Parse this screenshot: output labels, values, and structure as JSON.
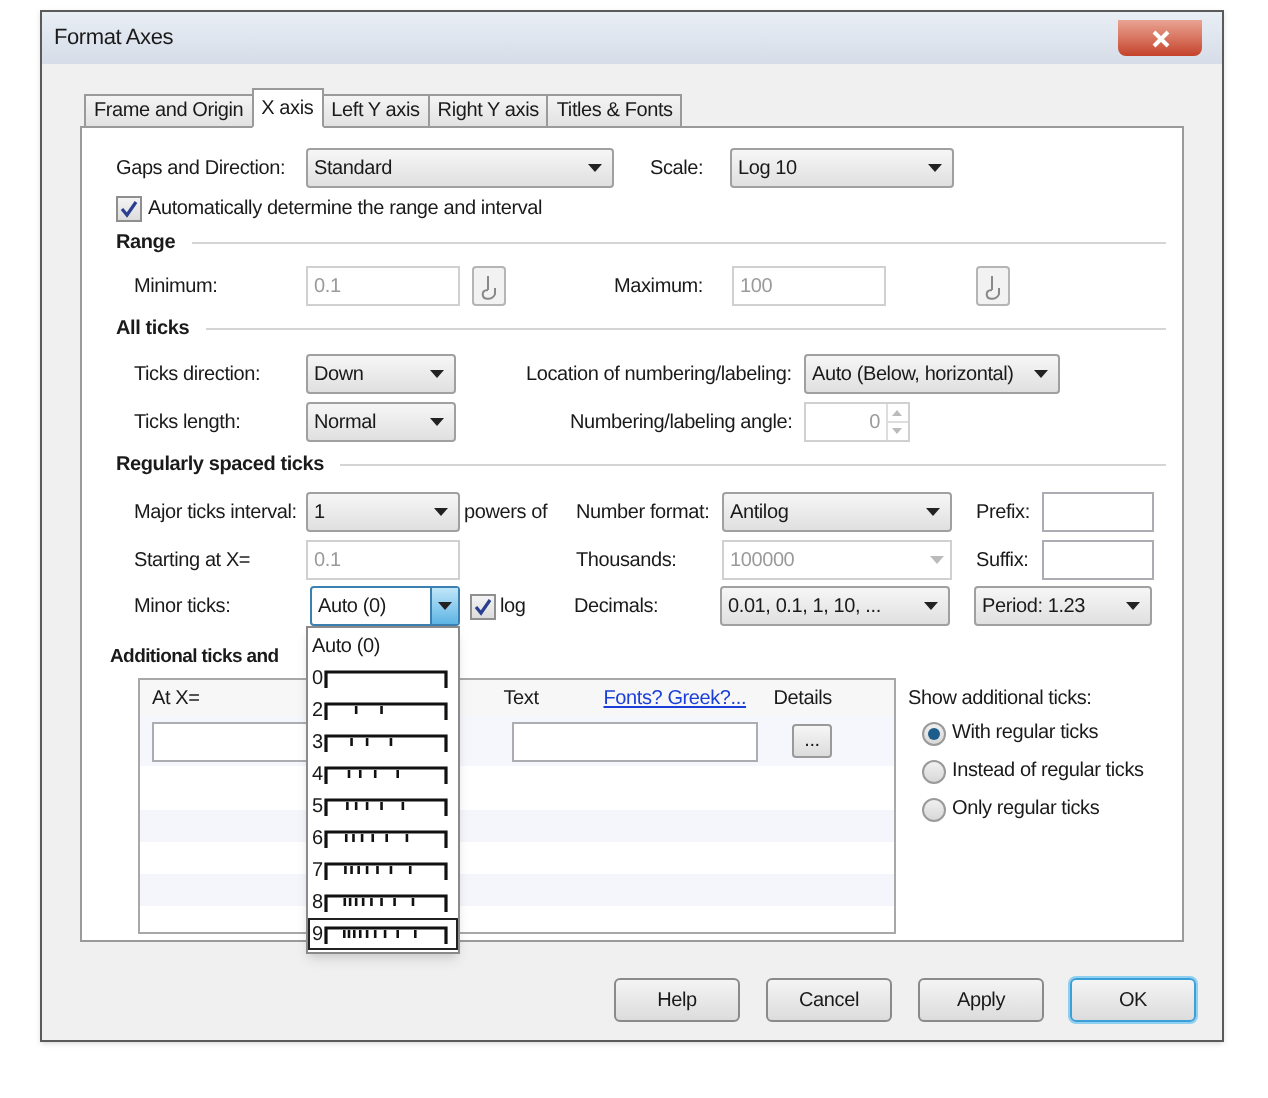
{
  "window": {
    "title": "Format Axes"
  },
  "tabs": [
    {
      "label": "Frame and Origin",
      "selected": false
    },
    {
      "label": "X axis",
      "selected": true
    },
    {
      "label": "Left Y axis",
      "selected": false
    },
    {
      "label": "Right Y axis",
      "selected": false
    },
    {
      "label": "Titles & Fonts",
      "selected": false
    }
  ],
  "gaps_direction": {
    "label": "Gaps and Direction:",
    "value": "Standard"
  },
  "scale": {
    "label": "Scale:",
    "value": "Log 10"
  },
  "auto_range": {
    "label": "Automatically determine the range and interval",
    "checked": true
  },
  "range": {
    "heading": "Range",
    "minimum": {
      "label": "Minimum:",
      "value": "0.1",
      "disabled": true
    },
    "maximum": {
      "label": "Maximum:",
      "value": "100",
      "disabled": true
    }
  },
  "all_ticks": {
    "heading": "All ticks",
    "direction": {
      "label": "Ticks direction:",
      "value": "Down"
    },
    "location": {
      "label": "Location of numbering/labeling:",
      "value": "Auto (Below, horizontal)"
    },
    "length": {
      "label": "Ticks length:",
      "value": "Normal"
    },
    "angle": {
      "label": "Numbering/labeling angle:",
      "value": "0",
      "disabled": true
    }
  },
  "regular_ticks": {
    "heading": "Regularly spaced ticks",
    "major_interval": {
      "label": "Major ticks interval:",
      "value": "1",
      "suffix": "powers of"
    },
    "number_format": {
      "label": "Number format:",
      "value": "Antilog"
    },
    "prefix": {
      "label": "Prefix:"
    },
    "starting_at": {
      "label": "Starting at X=",
      "value": "0.1",
      "disabled": true
    },
    "thousands": {
      "label": "Thousands:",
      "value": "100000",
      "disabled": true
    },
    "suffix": {
      "label": "Suffix:"
    },
    "minor_ticks": {
      "label": "Minor ticks:",
      "value": "Auto (0)",
      "expanded": true
    },
    "log": {
      "label": "log",
      "checked": true
    },
    "decimals": {
      "label": "Decimals:",
      "value": "0.01, 0.1, 1, 10, ..."
    },
    "period": {
      "value": "Period: 1.23"
    }
  },
  "minor_ticks_options": [
    {
      "label": "Auto (0)",
      "selected": false
    },
    {
      "label": "0",
      "selected": false
    },
    {
      "label": "2",
      "selected": false
    },
    {
      "label": "3",
      "selected": false
    },
    {
      "label": "4",
      "selected": false
    },
    {
      "label": "5",
      "selected": false
    },
    {
      "label": "6",
      "selected": false
    },
    {
      "label": "7",
      "selected": false
    },
    {
      "label": "8",
      "selected": false
    },
    {
      "label": "9",
      "selected": true
    }
  ],
  "additional_ticks": {
    "heading": "Additional ticks and",
    "columns": [
      "At X=",
      "Text",
      "Details"
    ],
    "link": "Fonts? Greek?...",
    "details_button": "...",
    "show_label": "Show additional ticks:",
    "show_options": [
      {
        "label": "With regular ticks",
        "selected": true
      },
      {
        "label": "Instead of regular ticks",
        "selected": false
      },
      {
        "label": "Only regular ticks",
        "selected": false
      }
    ]
  },
  "buttons": [
    {
      "label": "Help",
      "default": false
    },
    {
      "label": "Cancel",
      "default": false
    },
    {
      "label": "Apply",
      "default": false
    },
    {
      "label": "OK",
      "default": true
    }
  ]
}
